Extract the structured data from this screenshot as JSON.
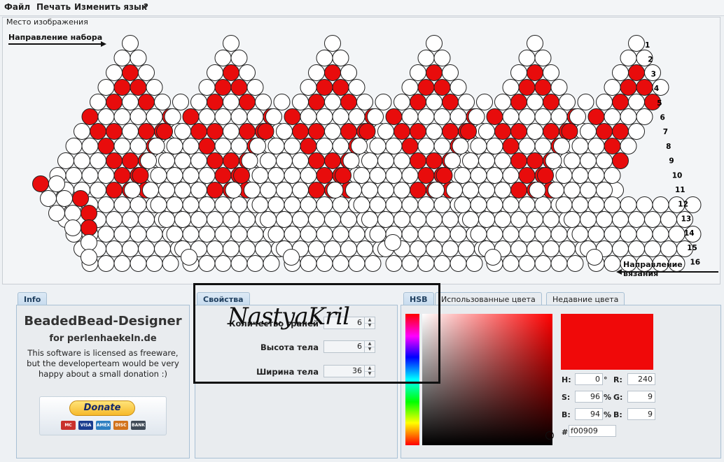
{
  "menu": [
    "Файл",
    "Печать",
    "Изменить язык",
    "?"
  ],
  "canvas": {
    "title": "Место изображения",
    "direction_set": "Направление набора",
    "direction_knit": "Направление вязания",
    "row_numbers": [
      "1",
      "2",
      "3",
      "4",
      "5",
      "6",
      "7",
      "8",
      "9",
      "10",
      "11",
      "12",
      "13",
      "14",
      "15",
      "16"
    ],
    "bead_white": "#ffffff",
    "bead_red": "#e80c0c"
  },
  "info_panel": {
    "tab": "Info",
    "title": "BeadedBead-Designer",
    "subtitle": "for perlenhaekeln.de",
    "text": "This software is licensed as freeware, but the developerteam would be very happy about a small donation :)",
    "donate": "Donate",
    "cards": [
      "MC",
      "VISA",
      "AMEX",
      "DISC",
      "BANK"
    ]
  },
  "properties_panel": {
    "tab": "Свойства",
    "faces_label": "Количество граней",
    "faces_value": "6",
    "height_label": "Высота тела",
    "height_value": "6",
    "width_label": "Ширина тела",
    "width_value": "36"
  },
  "watermark": "NastyaKril",
  "color_panel": {
    "tabs": [
      "HSB",
      "Использованные цвета",
      "Недавние цвета"
    ],
    "selected_color": "#f00909",
    "h_label": "H:",
    "h_value": "0",
    "h_unit": "°",
    "s_label": "S:",
    "s_value": "96",
    "s_unit": "%",
    "b_label": "B:",
    "b_value": "94",
    "b_unit": "%",
    "r_label": "R:",
    "r_value": "240",
    "g_label": "G:",
    "g_value": "9",
    "bl_label": "B:",
    "bl_value": "9",
    "hex_label": "#",
    "hex_value": "f00909"
  }
}
